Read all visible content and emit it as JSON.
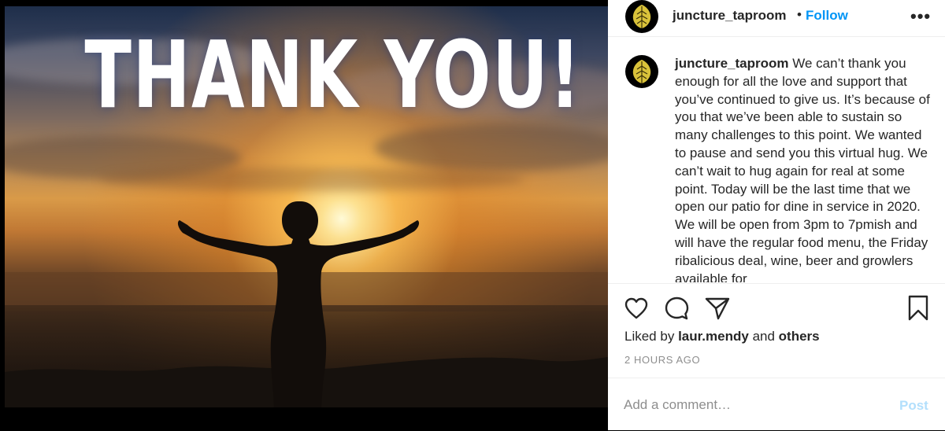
{
  "image": {
    "overlay_text": "THANK YOU!",
    "description_icon": "sunset-silhouette-image"
  },
  "header": {
    "username": "juncture_taproom",
    "separator": "•",
    "follow_label": "Follow",
    "more_label": "•••"
  },
  "caption": {
    "username": "juncture_taproom",
    "text": "We can’t thank you enough for all the love and support that you’ve continued to give us. It’s because of you that we’ve been able to sustain so many challenges to this point. We wanted to pause and send you this virtual hug. We can’t wait to hug again for real at some point. Today will be the last time that we open our patio for dine in service in 2020. We will be open from 3pm to 7pmish and will have the regular food menu, the Friday ribalicious deal, wine, beer and growlers available for"
  },
  "actions": {
    "like_icon": "heart-icon",
    "comment_icon": "comment-icon",
    "share_icon": "paper-plane-icon",
    "save_icon": "bookmark-icon"
  },
  "likes": {
    "prefix": "Liked by",
    "user": "laur.mendy",
    "conjunction": "and",
    "others": "others"
  },
  "timestamp": "2 HOURS AGO",
  "comment": {
    "placeholder": "Add a comment…",
    "post_label": "Post"
  },
  "colors": {
    "accent": "#0095f6",
    "post_disabled": "#b2dffc",
    "text": "#262626",
    "muted": "#8e8e8e"
  }
}
